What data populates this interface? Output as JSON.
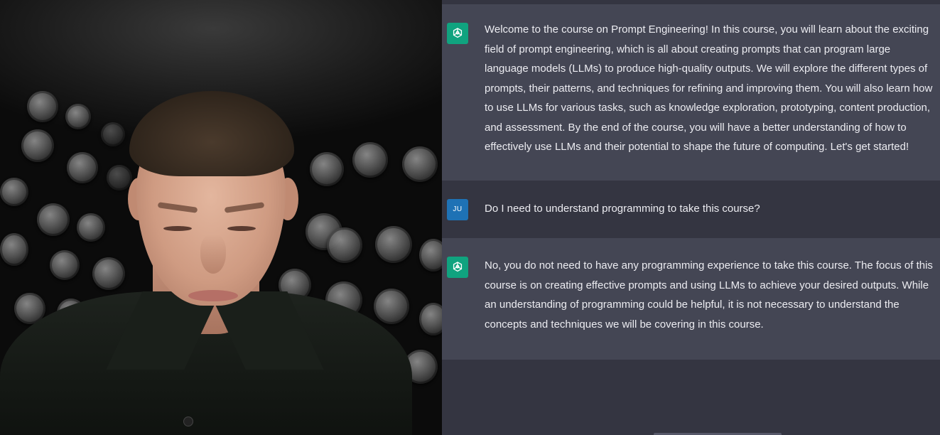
{
  "video": {
    "description_icon": "presenter-webcam"
  },
  "chat": {
    "messages": [
      {
        "role": "assistant",
        "avatar_icon": "openai-logo-icon",
        "text": "Welcome to the course on Prompt Engineering! In this course, you will learn about the exciting field of prompt engineering, which is all about creating prompts that can program large language models (LLMs) to produce high-quality outputs. We will explore the different types of prompts, their patterns, and techniques for refining and improving them. You will also learn how to use LLMs for various tasks, such as knowledge exploration, prototyping, content production, and assessment. By the end of the course, you will have a better understanding of how to effectively use LLMs and their potential to shape the future of computing. Let's get started!"
      },
      {
        "role": "user",
        "avatar_initials": "JU",
        "text": "Do I need to understand programming to take this course?"
      },
      {
        "role": "assistant",
        "avatar_icon": "openai-logo-icon",
        "text": "No, you do not need to have any programming experience to take this course. The focus of this course is on creating effective prompts and using LLMs to achieve your desired outputs. While an understanding of programming could be helpful, it is not necessary to understand the concepts and techniques we will be covering in this course."
      }
    ]
  },
  "colors": {
    "assistant_bg": "#444654",
    "user_bg": "#343541",
    "gpt_avatar": "#10a37f",
    "user_avatar": "#1e72b5",
    "text": "#ececf1"
  }
}
